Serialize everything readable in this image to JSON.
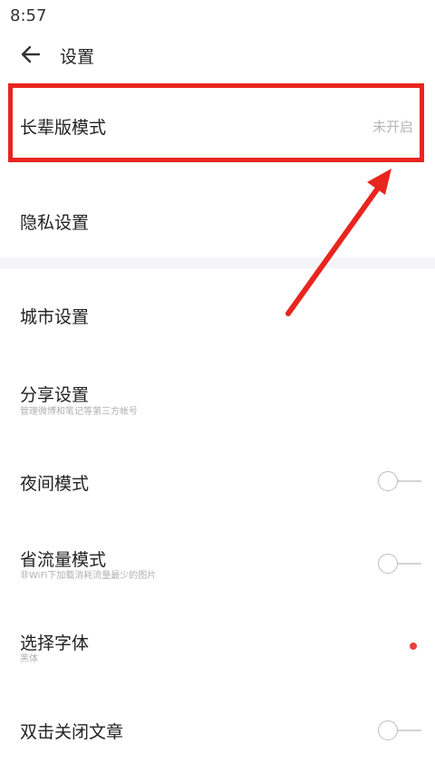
{
  "status_bar": {
    "time": "8:57"
  },
  "header": {
    "title": "设置",
    "back_icon": "arrow-left-icon"
  },
  "settings": [
    {
      "label": "长辈版模式",
      "value": "未开启"
    },
    {
      "label": "隐私设置"
    },
    {
      "label": "城市设置"
    },
    {
      "label": "分享设置",
      "subtitle": "管理微博和笔记等第三方帐号"
    },
    {
      "label": "夜间模式",
      "toggle": false
    },
    {
      "label": "省流量模式",
      "subtitle": "非WiFi下加载消耗流量最少的图片",
      "toggle": false
    },
    {
      "label": "选择字体",
      "subtitle": "黑体",
      "indicator": "red-dot"
    },
    {
      "label": "双击关闭文章",
      "toggle": false
    }
  ],
  "colors": {
    "annotation": "#e8251f",
    "accent_dot": "#e8423a",
    "toggle_off": "#bdbdbd"
  }
}
